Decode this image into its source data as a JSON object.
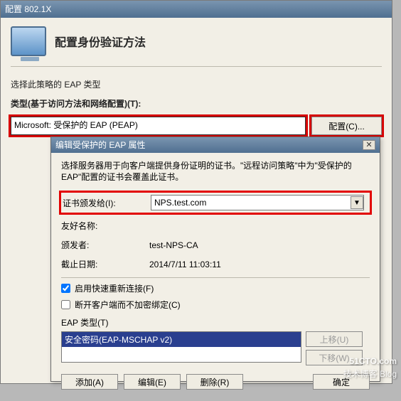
{
  "outer": {
    "window_title": "配置 802.1X",
    "heading": "配置身份验证方法",
    "select_eap_label": "选择此策略的 EAP 类型",
    "type_label": "类型(基于访问方法和网络配置)(T):",
    "eap_selected": "Microsoft: 受保护的 EAP (PEAP)",
    "configure_btn": "配置(C)..."
  },
  "inner": {
    "window_title": "编辑受保护的 EAP 属性",
    "intro": "选择服务器用于向客户端提供身份证明的证书。\"远程访问策略\"中为\"受保护的 EAP\"配置的证书会覆盖此证书。",
    "cert_issued_to_label": "证书颁发给(I):",
    "cert_issued_to_value": "NPS.test.com",
    "friendly_name_label": "友好名称:",
    "friendly_name_value": "",
    "issuer_label": "颁发者:",
    "issuer_value": "test-NPS-CA",
    "expiry_label": "截止日期:",
    "expiry_value": "2014/7/11 11:03:11",
    "fast_reconnect_label": "启用快速重新连接(F)",
    "fast_reconnect_checked": true,
    "disconnect_nocipher_label": "断开客户端而不加密绑定(C)",
    "disconnect_nocipher_checked": false,
    "eap_types_label": "EAP 类型(T)",
    "eap_list": [
      "安全密码(EAP-MSCHAP v2)"
    ],
    "move_up_btn": "上移(U)",
    "move_down_btn": "下移(W)",
    "add_btn": "添加(A)",
    "edit_btn": "编辑(E)",
    "delete_btn": "删除(R)",
    "ok_btn": "确定"
  },
  "watermark": {
    "main": "51CTO.com",
    "sub": "技术博客  Blog"
  }
}
